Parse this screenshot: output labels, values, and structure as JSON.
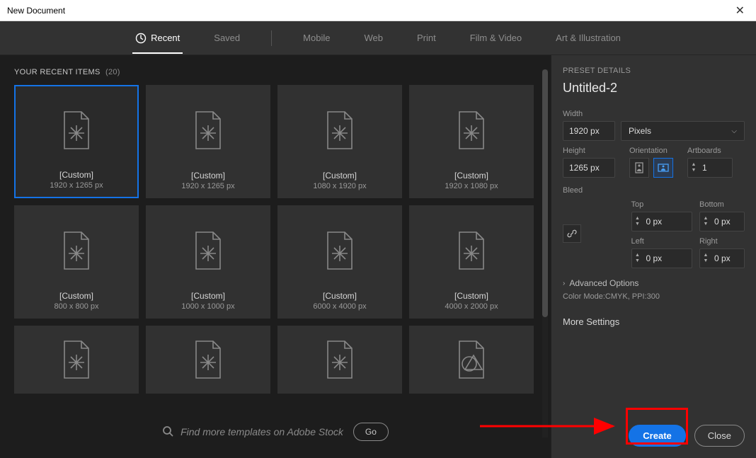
{
  "window": {
    "title": "New Document"
  },
  "tabs": [
    "Recent",
    "Saved",
    "Mobile",
    "Web",
    "Print",
    "Film & Video",
    "Art & Illustration"
  ],
  "active_tab": 0,
  "recent_header": {
    "label": "YOUR RECENT ITEMS",
    "count": "(20)"
  },
  "cards": [
    {
      "label": "[Custom]",
      "dims": "1920 x 1265 px",
      "selected": true,
      "type": "doc"
    },
    {
      "label": "[Custom]",
      "dims": "1920 x 1265 px",
      "type": "doc"
    },
    {
      "label": "[Custom]",
      "dims": "1080 x 1920 px",
      "type": "doc"
    },
    {
      "label": "[Custom]",
      "dims": "1920 x 1080 px",
      "type": "doc"
    },
    {
      "label": "[Custom]",
      "dims": "800 x 800 px",
      "type": "doc"
    },
    {
      "label": "[Custom]",
      "dims": "1000 x 1000 px",
      "type": "doc"
    },
    {
      "label": "[Custom]",
      "dims": "6000 x 4000 px",
      "type": "doc"
    },
    {
      "label": "[Custom]",
      "dims": "4000 x 2000 px",
      "type": "doc"
    },
    {
      "label": "",
      "dims": "",
      "type": "doc"
    },
    {
      "label": "",
      "dims": "",
      "type": "doc"
    },
    {
      "label": "",
      "dims": "",
      "type": "doc"
    },
    {
      "label": "",
      "dims": "",
      "type": "shape"
    }
  ],
  "search": {
    "placeholder": "Find more templates on Adobe Stock",
    "go": "Go"
  },
  "preset": {
    "section": "PRESET DETAILS",
    "name": "Untitled-2",
    "width_label": "Width",
    "width": "1920 px",
    "units": "Pixels",
    "height_label": "Height",
    "height": "1265 px",
    "orient_label": "Orientation",
    "artboards_label": "Artboards",
    "artboards": "1",
    "bleed_label": "Bleed",
    "top_label": "Top",
    "top": "0 px",
    "bottom_label": "Bottom",
    "bottom": "0 px",
    "left_label": "Left",
    "left": "0 px",
    "right_label": "Right",
    "right": "0 px",
    "advanced": "Advanced Options",
    "mode_info": "Color Mode:CMYK, PPI:300",
    "more": "More Settings"
  },
  "buttons": {
    "create": "Create",
    "close": "Close"
  }
}
